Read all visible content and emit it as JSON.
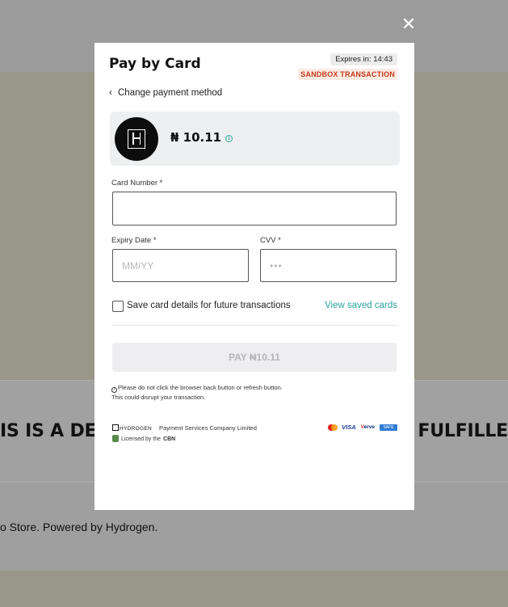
{
  "background": {
    "band_left_text": "IS IS A DEM",
    "band_right_text": "E FULFILLE",
    "footer_text": "o Store. Powered by Hydrogen."
  },
  "modal": {
    "close_glyph": "✕",
    "title": "Pay by Card",
    "expires_prefix": "Expires in:",
    "expires_time": "14:43",
    "sandbox_badge": "SANDBOX TRANSACTION",
    "change_method": "Change payment method",
    "amount": "₦ 10.11",
    "card_number_label": "Card Number *",
    "expiry_label": "Expiry Date *",
    "expiry_placeholder": "MM/YY",
    "cvv_label": "CVV *",
    "cvv_placeholder": "•••",
    "save_card_label": "Save card details for future transactions",
    "view_saved_cards": "View saved cards",
    "pay_button": "PAY ₦10.11",
    "warning_line1": "Please do not click the browser back button or refresh button.",
    "warning_line2": "This could disrupt your transaction.",
    "brand_name": "HYDROGEN",
    "company": "Payment Services Company Limited",
    "licensed_by": "Licensed by the",
    "regulator": "CBN",
    "card_brands": {
      "visa": "VISA",
      "verve_v": "V",
      "verve_rest": "erve",
      "safetoken": "SAFE"
    }
  },
  "colors": {
    "accent": "#2ba59a",
    "sandbox_text": "#c23a1a",
    "sandbox_bg": "#fdeae3"
  }
}
